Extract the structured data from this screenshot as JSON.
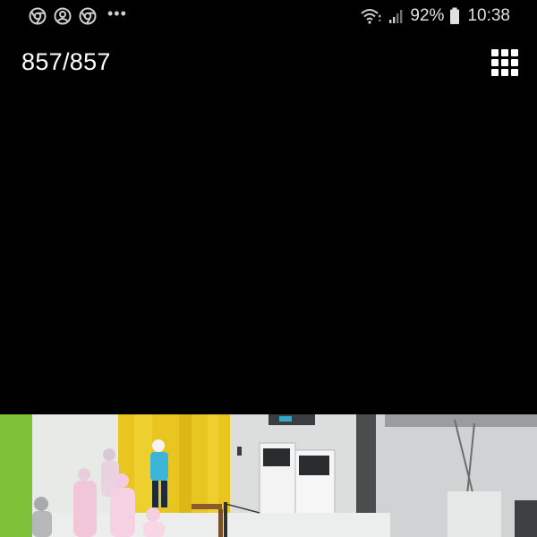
{
  "status_bar": {
    "left_icons": [
      "chrome-icon",
      "account-circle-icon",
      "chrome-icon"
    ],
    "overflow_label": "•••",
    "battery_level": "92%",
    "time": "10:38",
    "right_icons": [
      "wifi-icon",
      "signal-icon",
      "battery-icon"
    ]
  },
  "header": {
    "counter": "857/857",
    "grid_icon": "grid-view-icon"
  },
  "photo": {
    "description_icon": "surveillance-photo"
  }
}
